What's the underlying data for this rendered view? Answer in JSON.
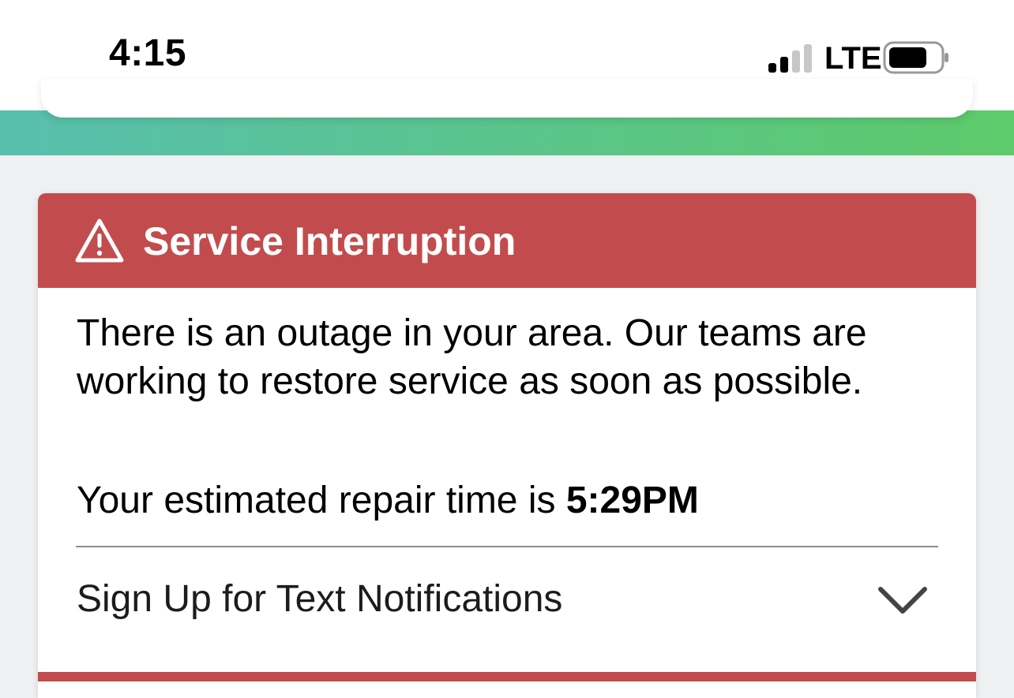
{
  "status_bar": {
    "time": "4:15",
    "network": "LTE",
    "signal_bars_filled": 2,
    "signal_bars_total": 4,
    "battery_level": 0.75
  },
  "theme": {
    "alert_color": "#c24c4d",
    "gradient_start": "#58bfae",
    "gradient_end": "#5dca6b"
  },
  "alert": {
    "icon": "warning-triangle-icon",
    "title": "Service Interruption",
    "message": "There is an outage in your area. Our teams are working to restore service as soon as possible.",
    "repair_prefix": "Your estimated repair time is ",
    "repair_time": "5:29PM",
    "notifications_label": "Sign Up for Text Notifications",
    "notifications_icon": "chevron-down-icon"
  }
}
